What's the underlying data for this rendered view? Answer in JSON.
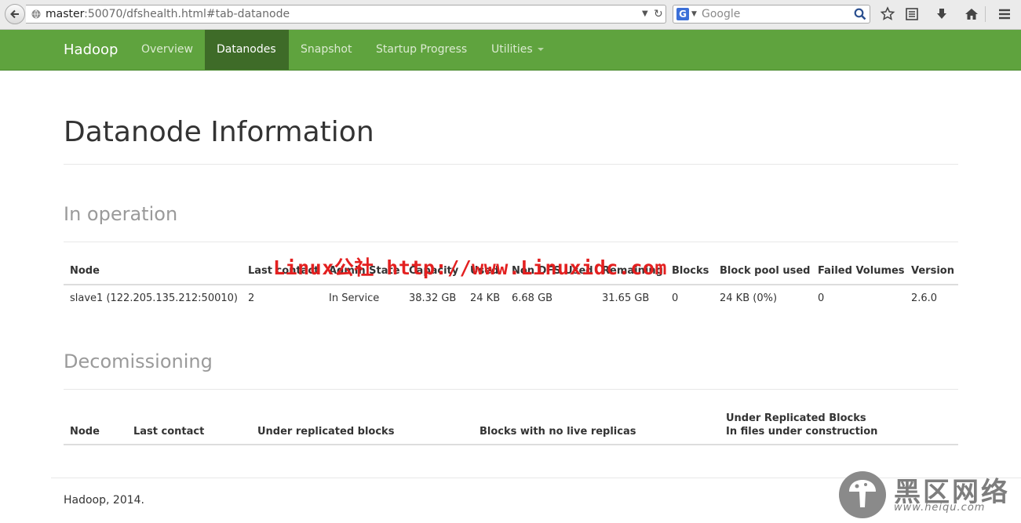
{
  "browser": {
    "url_host": "master",
    "url_rest": ":50070/dfshealth.html#tab-datanode",
    "search_engine": "G",
    "search_placeholder": "Google"
  },
  "navbar": {
    "brand": "Hadoop",
    "items": [
      {
        "label": "Overview"
      },
      {
        "label": "Datanodes"
      },
      {
        "label": "Snapshot"
      },
      {
        "label": "Startup Progress"
      },
      {
        "label": "Utilities"
      }
    ],
    "active": "Datanodes",
    "bg_color": "#5fa33e",
    "active_color": "#3e6b28"
  },
  "page": {
    "title": "Datanode Information"
  },
  "in_operation": {
    "title": "In operation",
    "headers": [
      "Node",
      "Last contact",
      "Admin State",
      "Capacity",
      "Used",
      "Non DFS Used",
      "Remaining",
      "Blocks",
      "Block pool used",
      "Failed Volumes",
      "Version"
    ],
    "rows": [
      [
        "slave1 (122.205.135.212:50010)",
        "2",
        "In Service",
        "38.32 GB",
        "24 KB",
        "6.68 GB",
        "31.65 GB",
        "0",
        "24 KB (0%)",
        "0",
        "2.6.0"
      ]
    ]
  },
  "decommissioning": {
    "title": "Decomissioning",
    "headers": [
      "Node",
      "Last contact",
      "Under replicated blocks",
      "Blocks with no live replicas",
      "Under Replicated Blocks",
      "In files under construction"
    ]
  },
  "footer": {
    "text": "Hadoop, 2014."
  },
  "watermark": {
    "text": "Linux公社 http://www.Linuxidc.com",
    "color": "#e32020"
  },
  "logo_watermark": {
    "chinese": "黑区网络",
    "url": "www.heiqu.com"
  }
}
